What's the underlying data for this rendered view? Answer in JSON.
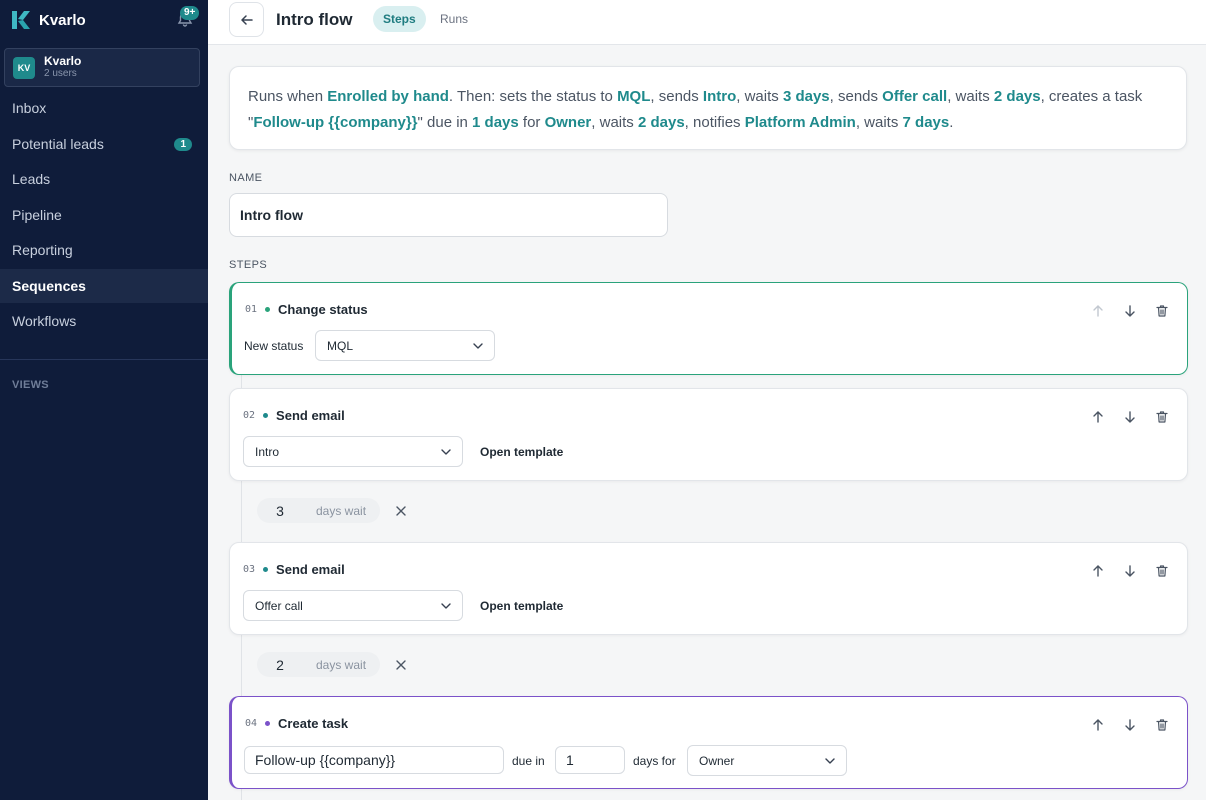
{
  "app": {
    "name": "Kvarlo",
    "notifications_badge": "9+"
  },
  "workspace": {
    "initials": "KV",
    "name": "Kvarlo",
    "subtitle": "2 users"
  },
  "nav": [
    {
      "label": "Inbox"
    },
    {
      "label": "Potential leads",
      "count": "1"
    },
    {
      "label": "Leads"
    },
    {
      "label": "Pipeline"
    },
    {
      "label": "Reporting"
    },
    {
      "label": "Sequences",
      "active": true
    },
    {
      "label": "Workflows"
    }
  ],
  "views_label": "VIEWS",
  "header": {
    "title": "Intro flow",
    "tabs": [
      {
        "label": "Steps",
        "active": true
      },
      {
        "label": "Runs"
      }
    ]
  },
  "summary": {
    "t1": "Runs when ",
    "h1": "Enrolled by hand",
    "t2": ". Then: sets the status to ",
    "h2": "MQL",
    "t3": ", sends ",
    "h3": "Intro",
    "t4": ", waits ",
    "h4": "3 days",
    "t5": ", sends ",
    "h5": "Offer call",
    "t6": ", waits ",
    "h6": "2 days",
    "t7": ", creates a task \"",
    "h7": "Follow-up {{company}}",
    "t8": "\" due in ",
    "h8": "1 days",
    "t9": " for ",
    "h9": "Owner",
    "t10": ", waits ",
    "h10": "2 days",
    "t11": ", notifies ",
    "h11": "Platform Admin",
    "t12": ", waits ",
    "h12": "7 days",
    "t13": "."
  },
  "form": {
    "name_label": "NAME",
    "name_value": "Intro flow",
    "steps_label": "STEPS"
  },
  "steps": [
    {
      "num": "01",
      "title": "Change status",
      "field_label": "New status",
      "select_value": "MQL"
    },
    {
      "num": "02",
      "title": "Send email",
      "select_value": "Intro",
      "link": "Open template"
    },
    {
      "num": "03",
      "title": "Send email",
      "select_value": "Offer call",
      "link": "Open template"
    },
    {
      "num": "04",
      "title": "Create task",
      "task_title": "Follow-up {{company}}",
      "due_label": "due in",
      "due_value": "1",
      "days_for_label": "days for",
      "assignee": "Owner"
    }
  ],
  "waits": [
    {
      "value": "3",
      "unit": "days wait"
    },
    {
      "value": "2",
      "unit": "days wait"
    }
  ],
  "colors": {
    "sidebar": "#0f1c3a",
    "accent": "#1f8a8c",
    "status_step": "#2aa37b",
    "task_step": "#7b52c9"
  }
}
